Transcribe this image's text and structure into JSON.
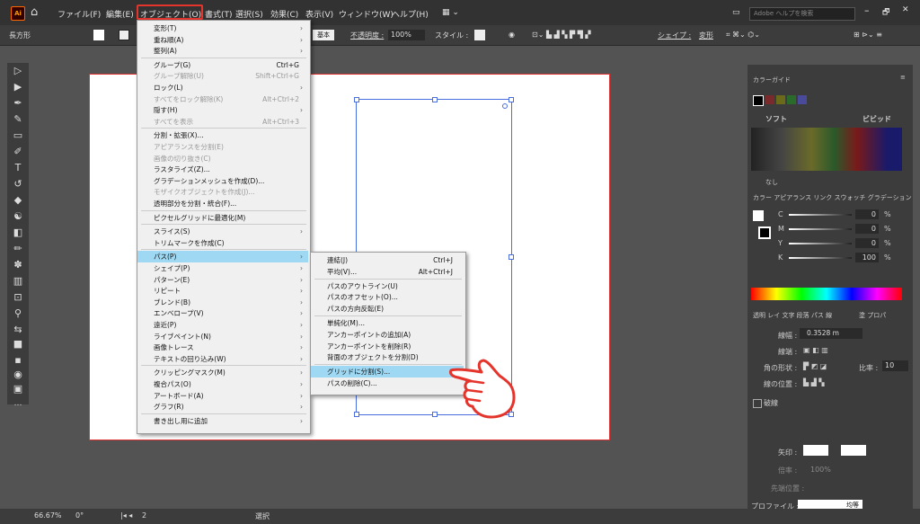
{
  "menubar": {
    "items": [
      "ファイル(F)",
      "編集(E)",
      "オブジェクト(O)",
      "書式(T)",
      "選択(S)",
      "効果(C)",
      "表示(V)",
      "ウィンドウ(W)",
      "ヘルプ(H)"
    ],
    "search_placeholder": "Adobe ヘルプを検索",
    "logo": "Ai"
  },
  "controlbar": {
    "shape_label": "長方形",
    "stroke_label": "基本",
    "opacity_label": "不透明度 :",
    "opacity_value": "100%",
    "style_label": "スタイル :",
    "shape_link": "シェイプ :",
    "transform_link": "変形"
  },
  "object_menu": {
    "items": [
      {
        "label": "変形(T)",
        "shortcut": "",
        "sub": true,
        "disabled": false
      },
      {
        "label": "重ね順(A)",
        "shortcut": "",
        "sub": true,
        "disabled": false
      },
      {
        "label": "整列(A)",
        "shortcut": "",
        "sub": true,
        "disabled": false
      },
      {
        "label": "グループ(G)",
        "shortcut": "Ctrl+G",
        "sub": false,
        "disabled": false
      },
      {
        "label": "グループ解除(U)",
        "shortcut": "Shift+Ctrl+G",
        "sub": false,
        "disabled": true
      },
      {
        "label": "ロック(L)",
        "shortcut": "",
        "sub": true,
        "disabled": false
      },
      {
        "label": "すべてをロック解除(K)",
        "shortcut": "Alt+Ctrl+2",
        "sub": false,
        "disabled": true
      },
      {
        "label": "隠す(H)",
        "shortcut": "",
        "sub": true,
        "disabled": false
      },
      {
        "label": "すべてを表示",
        "shortcut": "Alt+Ctrl+3",
        "sub": false,
        "disabled": true
      },
      {
        "label": "分割・拡張(X)...",
        "shortcut": "",
        "sub": false,
        "disabled": false
      },
      {
        "label": "アピアランスを分割(E)",
        "shortcut": "",
        "sub": false,
        "disabled": true
      },
      {
        "label": "画像の切り抜き(C)",
        "shortcut": "",
        "sub": false,
        "disabled": true
      },
      {
        "label": "ラスタライズ(Z)...",
        "shortcut": "",
        "sub": false,
        "disabled": false
      },
      {
        "label": "グラデーションメッシュを作成(D)...",
        "shortcut": "",
        "sub": false,
        "disabled": false
      },
      {
        "label": "モザイクオブジェクトを作成(J)...",
        "shortcut": "",
        "sub": false,
        "disabled": true
      },
      {
        "label": "透明部分を分割・統合(F)...",
        "shortcut": "",
        "sub": false,
        "disabled": false
      },
      {
        "label": "ピクセルグリッドに最適化(M)",
        "shortcut": "",
        "sub": false,
        "disabled": false
      },
      {
        "label": "スライス(S)",
        "shortcut": "",
        "sub": true,
        "disabled": false
      },
      {
        "label": "トリムマークを作成(C)",
        "shortcut": "",
        "sub": false,
        "disabled": false
      },
      {
        "label": "パス(P)",
        "shortcut": "",
        "sub": true,
        "disabled": false,
        "highlight": true
      },
      {
        "label": "シェイプ(P)",
        "shortcut": "",
        "sub": true,
        "disabled": false
      },
      {
        "label": "パターン(E)",
        "shortcut": "",
        "sub": true,
        "disabled": false
      },
      {
        "label": "リピート",
        "shortcut": "",
        "sub": true,
        "disabled": false
      },
      {
        "label": "ブレンド(B)",
        "shortcut": "",
        "sub": true,
        "disabled": false
      },
      {
        "label": "エンベロープ(V)",
        "shortcut": "",
        "sub": true,
        "disabled": false
      },
      {
        "label": "遠近(P)",
        "shortcut": "",
        "sub": true,
        "disabled": false
      },
      {
        "label": "ライブペイント(N)",
        "shortcut": "",
        "sub": true,
        "disabled": false
      },
      {
        "label": "画像トレース",
        "shortcut": "",
        "sub": true,
        "disabled": false
      },
      {
        "label": "テキストの回り込み(W)",
        "shortcut": "",
        "sub": true,
        "disabled": false
      },
      {
        "label": "クリッピングマスク(M)",
        "shortcut": "",
        "sub": true,
        "disabled": false
      },
      {
        "label": "複合パス(O)",
        "shortcut": "",
        "sub": true,
        "disabled": false
      },
      {
        "label": "アートボード(A)",
        "shortcut": "",
        "sub": true,
        "disabled": false
      },
      {
        "label": "グラフ(R)",
        "shortcut": "",
        "sub": true,
        "disabled": false
      },
      {
        "label": "書き出し用に追加",
        "shortcut": "",
        "sub": true,
        "disabled": false
      }
    ]
  },
  "path_menu": {
    "items": [
      {
        "label": "連結(J)",
        "shortcut": "Ctrl+J"
      },
      {
        "label": "平均(V)...",
        "shortcut": "Alt+Ctrl+J"
      },
      {
        "label": "パスのアウトライン(U)",
        "shortcut": ""
      },
      {
        "label": "パスのオフセット(O)...",
        "shortcut": ""
      },
      {
        "label": "パスの方向反転(E)",
        "shortcut": ""
      },
      {
        "label": "単純化(M)...",
        "shortcut": ""
      },
      {
        "label": "アンカーポイントの追加(A)",
        "shortcut": ""
      },
      {
        "label": "アンカーポイントを削除(R)",
        "shortcut": ""
      },
      {
        "label": "背面のオブジェクトを分割(D)",
        "shortcut": ""
      },
      {
        "label": "グリッドに分割(S)...",
        "shortcut": "",
        "highlight": true
      },
      {
        "label": "パスの削除(C)...",
        "shortcut": ""
      }
    ]
  },
  "rpanel": {
    "guide_title": "カラーガイド",
    "soft": "ソフト",
    "vivid": "ビビッド",
    "none": "なし",
    "color_tabs": "カラー  アピアランス  リンク  スウォッチ  グラデーション",
    "cmyk": [
      {
        "ch": "C",
        "val": "0",
        "unit": "%"
      },
      {
        "ch": "M",
        "val": "0",
        "unit": "%"
      },
      {
        "ch": "Y",
        "val": "0",
        "unit": "%"
      },
      {
        "ch": "K",
        "val": "100",
        "unit": "%"
      }
    ],
    "stroke_tabs": "透明  レイ  文字  段落  パス  線",
    "extra_tabs": "塗  プロパ",
    "weight_label": "線幅 :",
    "weight_value": "0.3528 m",
    "cap_label": "線端 :",
    "corner_label": "角の形状 :",
    "limit_label": "比率 :",
    "limit_value": "10",
    "align_label": "線の位置 :",
    "dashed_label": "破線",
    "arrow_label": "矢印 :",
    "scale_label": "倍率 :",
    "scale_value": "100%",
    "tip_label": "先端位置 :",
    "profile_label": "プロファイル :",
    "profile_value": "均等"
  },
  "status": {
    "zoom": "66.67%",
    "rotate": "0°",
    "page": "2",
    "tool": "選択"
  },
  "colors": {
    "accent": "#e5342c",
    "highlight": "#9fd8f2",
    "selection": "#4a6ee0"
  }
}
